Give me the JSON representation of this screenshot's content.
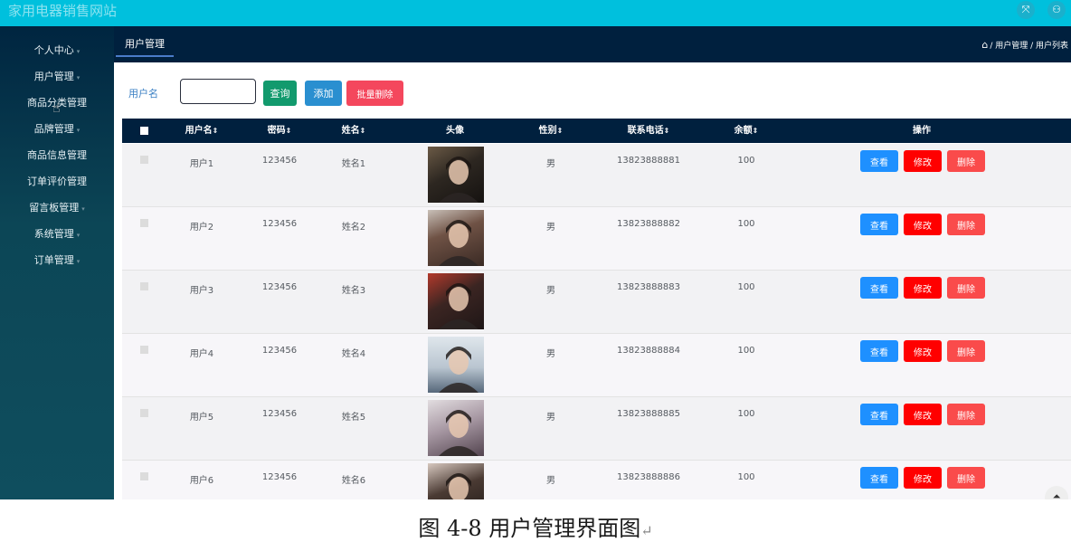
{
  "app": {
    "title": "家用电器销售网站"
  },
  "topbar_icons": [
    {
      "name": "fullscreen-icon",
      "glyph": "⤧"
    },
    {
      "name": "user-icon",
      "glyph": "⚇"
    }
  ],
  "sidebar": {
    "items": [
      {
        "label": "个人中心",
        "caret": "▾"
      },
      {
        "label": "用户管理",
        "caret": "▾"
      },
      {
        "label": "商品分类管理",
        "caret": ""
      },
      {
        "label": "品牌管理",
        "caret": "▾"
      },
      {
        "label": "商品信息管理",
        "caret": ""
      },
      {
        "label": "订单评价管理",
        "caret": ""
      },
      {
        "label": "留言板管理",
        "caret": "▾"
      },
      {
        "label": "系统管理",
        "caret": "▾"
      },
      {
        "label": "订单管理",
        "caret": "▾"
      }
    ]
  },
  "header": {
    "tab_label": "用户管理",
    "breadcrumb": "/ 用户管理 / 用户列表"
  },
  "search": {
    "label": "用户名",
    "input_value": "",
    "query_label": "查询",
    "add_label": "添加",
    "batch_delete_label": "批量删除"
  },
  "table": {
    "columns": [
      "用户名",
      "密码",
      "姓名",
      "头像",
      "性别",
      "联系电话",
      "余额",
      "操作"
    ],
    "sort_glyph": "⇕",
    "rows": [
      {
        "username": "用户1",
        "password": "123456",
        "name": "姓名1",
        "gender": "男",
        "phone": "13823888881",
        "balance": "100"
      },
      {
        "username": "用户2",
        "password": "123456",
        "name": "姓名2",
        "gender": "男",
        "phone": "13823888882",
        "balance": "100"
      },
      {
        "username": "用户3",
        "password": "123456",
        "name": "姓名3",
        "gender": "男",
        "phone": "13823888883",
        "balance": "100"
      },
      {
        "username": "用户4",
        "password": "123456",
        "name": "姓名4",
        "gender": "男",
        "phone": "13823888884",
        "balance": "100"
      },
      {
        "username": "用户5",
        "password": "123456",
        "name": "姓名5",
        "gender": "男",
        "phone": "13823888885",
        "balance": "100"
      },
      {
        "username": "用户6",
        "password": "123456",
        "name": "姓名6",
        "gender": "男",
        "phone": "13823888886",
        "balance": "100"
      }
    ],
    "actions": {
      "view": "查看",
      "edit": "修改",
      "delete": "删除"
    }
  },
  "scroll_top_glyph": "⏶",
  "caption": {
    "text": "图 4-8 用户管理界面图",
    "return_mark": "↵"
  }
}
